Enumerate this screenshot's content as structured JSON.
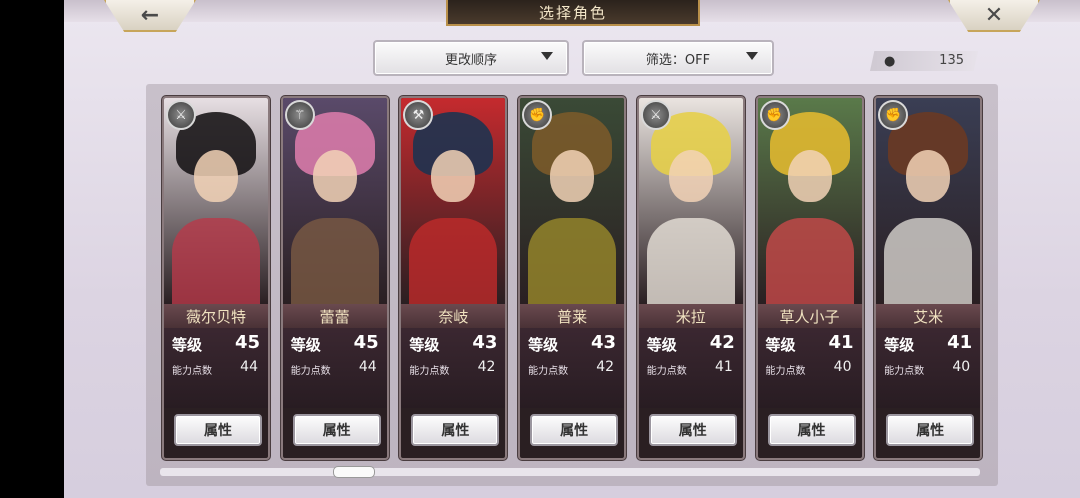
{
  "header": {
    "title": "选择角色",
    "back_icon": "←",
    "close_icon": "✕"
  },
  "toolbar": {
    "sort_label": "更改顺序",
    "filter_label": "筛选：OFF",
    "character_count": "135"
  },
  "labels": {
    "level": "等级",
    "points": "能力点数",
    "attributes": "属性"
  },
  "characters": [
    {
      "name": "薇尔贝特",
      "level": "45",
      "points": "44",
      "class_icon": "sword",
      "hair": "#1a1618",
      "body": "#b83a4a",
      "bg": "#e7dfe3"
    },
    {
      "name": "蕾蕾",
      "level": "45",
      "points": "44",
      "class_icon": "staff",
      "hair": "#d77aa8",
      "body": "#7a5a44",
      "bg": "#5a4a6a"
    },
    {
      "name": "奈岐",
      "level": "43",
      "points": "42",
      "class_icon": "axe",
      "hair": "#1e3350",
      "body": "#c02a2a",
      "bg": "#c52a2e"
    },
    {
      "name": "普莱",
      "level": "43",
      "points": "42",
      "class_icon": "fist",
      "hair": "#7a5a2a",
      "body": "#9a8a2a",
      "bg": "#3a4a36"
    },
    {
      "name": "米拉",
      "level": "42",
      "points": "41",
      "class_icon": "sword",
      "hair": "#e6cf4a",
      "body": "#e8e2da",
      "bg": "#eae4e0"
    },
    {
      "name": "草人小子",
      "level": "41",
      "points": "40",
      "class_icon": "fist",
      "hair": "#e0b830",
      "body": "#c84a4a",
      "bg": "#5a7a4a"
    },
    {
      "name": "艾米",
      "level": "41",
      "points": "40",
      "class_icon": "fist",
      "hair": "#6a3a24",
      "body": "#d8d4d0",
      "bg": "#3a3e54"
    }
  ]
}
